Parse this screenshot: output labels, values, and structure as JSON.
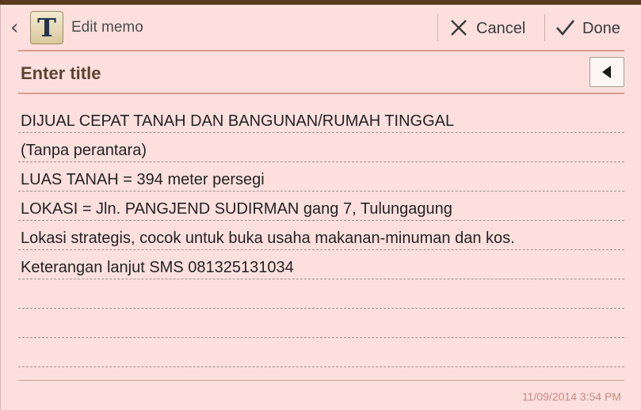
{
  "app": {
    "title": "Edit memo",
    "icon_glyph": "T",
    "icon_name": "text-memo-app-icon"
  },
  "toolbar": {
    "cancel_label": "Cancel",
    "done_label": "Done"
  },
  "memo": {
    "title_placeholder": "Enter title",
    "lines": [
      "DIJUAL CEPAT TANAH DAN BANGUNAN/RUMAH TINGGAL",
      "(Tanpa perantara)",
      "LUAS TANAH = 394 meter persegi",
      "LOKASI = Jln. PANGJEND SUDIRMAN gang 7, Tulungagung",
      "Lokasi strategis, cocok untuk buka usaha makanan-minuman dan kos.",
      "Keterangan lanjut SMS 081325131034",
      "",
      "",
      "",
      ""
    ],
    "timestamp": "11/09/2014 3:54 PM"
  },
  "colors": {
    "background": "#fde0dd",
    "rule": "#d79a92",
    "timestamp": "#c98a84",
    "title_text": "#5b4330"
  }
}
